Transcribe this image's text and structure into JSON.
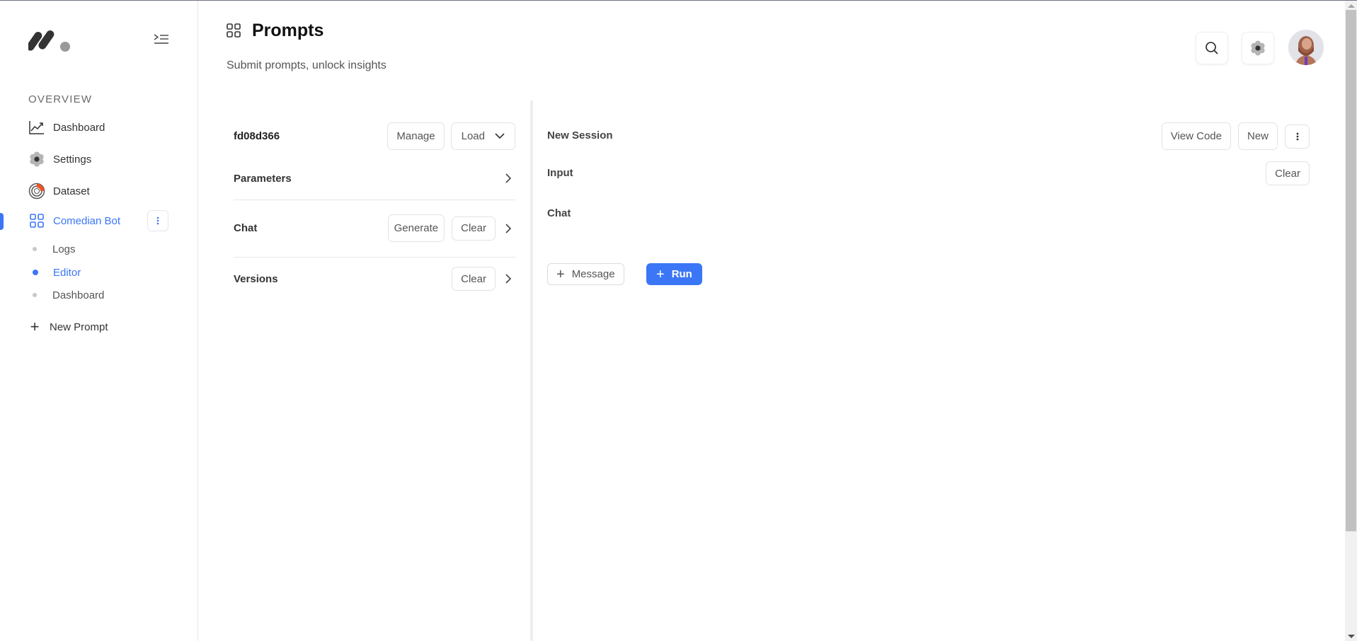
{
  "sidebar": {
    "section_label": "OVERVIEW",
    "items": [
      {
        "label": "Dashboard",
        "icon": "chart-line-icon"
      },
      {
        "label": "Settings",
        "icon": "gear-icon"
      },
      {
        "label": "Dataset",
        "icon": "dataset-icon"
      },
      {
        "label": "Comedian Bot",
        "icon": "grid-icon",
        "active": true
      }
    ],
    "sub_items": [
      {
        "label": "Logs",
        "active": false
      },
      {
        "label": "Editor",
        "active": true
      },
      {
        "label": "Dashboard",
        "active": false
      }
    ],
    "new_prompt_label": "New Prompt"
  },
  "header": {
    "title": "Prompts",
    "subtitle": "Submit prompts, unlock insights"
  },
  "left_panel": {
    "prompt_id": "fd08d366",
    "manage_label": "Manage",
    "load_label": "Load",
    "parameters_label": "Parameters",
    "chat_label": "Chat",
    "generate_label": "Generate",
    "chat_clear_label": "Clear",
    "versions_label": "Versions",
    "versions_clear_label": "Clear"
  },
  "right_panel": {
    "session_title": "New Session",
    "view_code_label": "View Code",
    "new_label": "New",
    "input_label": "Input",
    "input_clear_label": "Clear",
    "chat_label": "Chat",
    "message_label": "Message",
    "run_label": "Run"
  },
  "colors": {
    "accent": "#3b76f6",
    "text": "#333333",
    "border": "#e5e7eb"
  }
}
